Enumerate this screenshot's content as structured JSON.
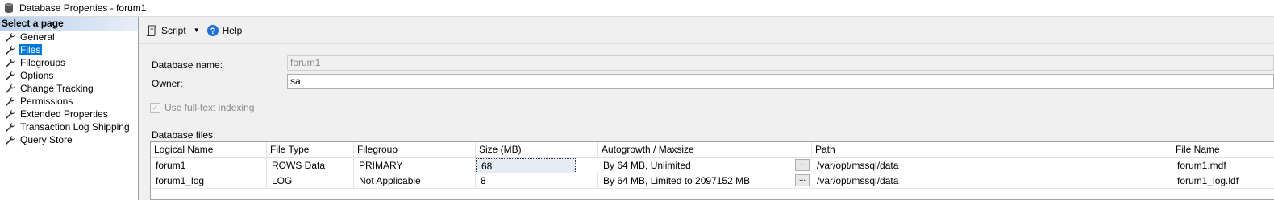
{
  "window": {
    "title": "Database Properties - forum1",
    "icon": "database-icon"
  },
  "sidebar": {
    "header": "Select a page",
    "items": [
      {
        "label": "General",
        "icon": "wrench-icon"
      },
      {
        "label": "Files",
        "icon": "wrench-icon",
        "selected": true
      },
      {
        "label": "Filegroups",
        "icon": "wrench-icon"
      },
      {
        "label": "Options",
        "icon": "wrench-icon"
      },
      {
        "label": "Change Tracking",
        "icon": "wrench-icon"
      },
      {
        "label": "Permissions",
        "icon": "wrench-icon"
      },
      {
        "label": "Extended Properties",
        "icon": "wrench-icon"
      },
      {
        "label": "Transaction Log Shipping",
        "icon": "wrench-icon"
      },
      {
        "label": "Query Store",
        "icon": "wrench-icon"
      }
    ]
  },
  "toolbar": {
    "script_label": "Script",
    "help_label": "Help"
  },
  "form": {
    "database_name_label": "Database name:",
    "database_name_value": "forum1",
    "owner_label": "Owner:",
    "owner_value": "sa",
    "fulltext_label": "Use full-text indexing",
    "fulltext_checked": true,
    "database_files_label": "Database files:"
  },
  "files_grid": {
    "columns": [
      "Logical Name",
      "File Type",
      "Filegroup",
      "Size (MB)",
      "Autogrowth / Maxsize",
      "Path",
      "File Name"
    ],
    "rows": [
      [
        "forum1",
        "ROWS Data",
        "PRIMARY",
        "68",
        "By 64 MB, Unlimited",
        "/var/opt/mssql/data",
        "forum1.mdf"
      ],
      [
        "forum1_log",
        "LOG",
        "Not Applicable",
        "8",
        "By 64 MB, Limited to 2097152 MB",
        "/var/opt/mssql/data",
        "forum1_log.ldf"
      ]
    ],
    "ellipsis_label": "..."
  },
  "colors": {
    "selection": "#0078d7",
    "header_gradient_start": "#b9d0ea",
    "help_icon": "#1e6fd9"
  }
}
